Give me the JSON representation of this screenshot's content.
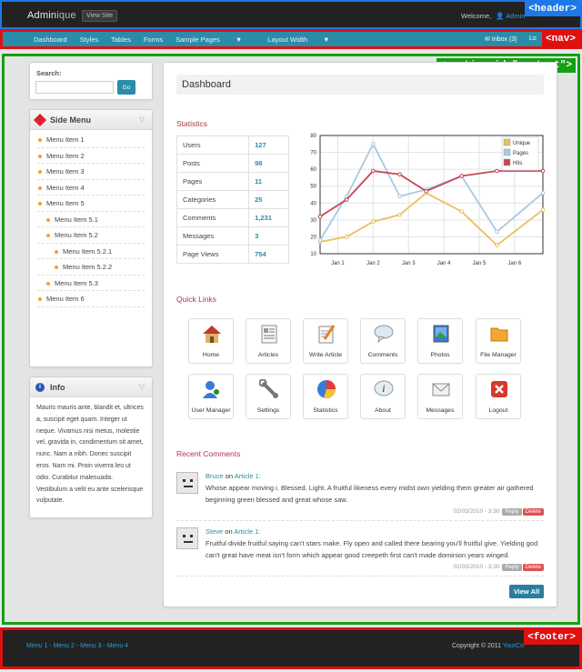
{
  "annotations": {
    "header": "<header>",
    "nav": "<nav>",
    "content": "<section id=\"content\">",
    "footer": "<footer>"
  },
  "header": {
    "brand_a": "Admin",
    "brand_b": "ique",
    "view_site": "View Site",
    "welcome": "Welcome,",
    "user_name": "Admin"
  },
  "nav": {
    "items": [
      "Dashboard",
      "Styles",
      "Tables",
      "Forms",
      "Sample Pages",
      "Layout Width"
    ],
    "inbox": "Inbox (3)",
    "logout": "Lo"
  },
  "search": {
    "label": "Search:",
    "placeholder": "",
    "button": "Go"
  },
  "side_menu": {
    "title": "Side Menu",
    "items": [
      "Menu Item 1",
      "Menu Item 2",
      "Menu Item 3",
      "Menu Item 4",
      "Menu Item 5",
      "Menu Item 5.1",
      "Menu Item 5.2",
      "Menu Item 5.2.1",
      "Menu Item 5.2.2",
      "Menu Item 5.3",
      "Menu Item 6"
    ]
  },
  "info": {
    "title": "Info",
    "text": "Mauris mauris ante, blandit et, ultrices a, suscipit eget quam. Integer ut neque. Vivamus nisi metus, molestie vel, gravida in, condimentum sit amet, nunc. Nam a nibh. Donec suscipit eros. Nam mi. Proin viverra leo ut odio. Curabitur malesuada. Vestibulum a velit eu ante scelerisque vulputate."
  },
  "main": {
    "title": "Dashboard",
    "statistics_heading": "Statistics",
    "quick_links_heading": "Quick Links",
    "recent_comments_heading": "Recent Comments",
    "view_all": "View All"
  },
  "stats": [
    {
      "label": "Users",
      "value": "127"
    },
    {
      "label": "Posts",
      "value": "98"
    },
    {
      "label": "Pages",
      "value": "11"
    },
    {
      "label": "Categories",
      "value": "25"
    },
    {
      "label": "Comments",
      "value": "1,231"
    },
    {
      "label": "Messages",
      "value": "3"
    },
    {
      "label": "Page Views",
      "value": "754"
    }
  ],
  "chart_data": {
    "type": "line",
    "x": [
      "Jan 1",
      "Jan 2",
      "Jan 3",
      "Jan 4",
      "Jan 5",
      "Jan 6"
    ],
    "xlim": [
      0.5,
      6.8
    ],
    "ylim": [
      10,
      80
    ],
    "yticks": [
      10,
      20,
      30,
      40,
      50,
      60,
      70,
      80
    ],
    "grid": true,
    "legend_position": "top-right",
    "series": [
      {
        "name": "Unique",
        "color": "#e8c15a",
        "x": [
          0.5,
          1.25,
          2,
          2.75,
          3.5,
          4.5,
          5.5,
          6.8
        ],
        "values": [
          17,
          20,
          29,
          33,
          46,
          35,
          15,
          36
        ]
      },
      {
        "name": "Pages",
        "color": "#a7c9e4",
        "x": [
          0.5,
          1.25,
          2,
          2.75,
          3.5,
          4.5,
          5.5,
          6.8
        ],
        "values": [
          18,
          44,
          75,
          44,
          48,
          56,
          23,
          46
        ]
      },
      {
        "name": "Hits",
        "color": "#c84455",
        "x": [
          0.5,
          1.25,
          2,
          2.75,
          3.5,
          4.5,
          5.5,
          6.8
        ],
        "values": [
          32,
          42,
          59,
          57,
          47,
          56,
          59,
          59
        ]
      }
    ]
  },
  "quick_links": [
    {
      "label": "Home",
      "icon": "home-icon"
    },
    {
      "label": "Articles",
      "icon": "articles-icon"
    },
    {
      "label": "Write Article",
      "icon": "write-article-icon"
    },
    {
      "label": "Comments",
      "icon": "comments-icon"
    },
    {
      "label": "Photos",
      "icon": "photos-icon"
    },
    {
      "label": "File Manager",
      "icon": "folder-icon"
    },
    {
      "label": "User Manager",
      "icon": "user-manager-icon"
    },
    {
      "label": "Settings",
      "icon": "settings-icon"
    },
    {
      "label": "Statistics",
      "icon": "pie-chart-icon"
    },
    {
      "label": "About",
      "icon": "about-icon"
    },
    {
      "label": "Messages",
      "icon": "envelope-icon"
    },
    {
      "label": "Logout",
      "icon": "logout-icon"
    }
  ],
  "comments": [
    {
      "author": "Bruce",
      "on": "on",
      "article": "Article 1:",
      "text": "Whose appear moving i. Blessed. Light. A fruitful likeness every midst own yielding them greater air gathered beginning green blessed and great whose saw.",
      "date": "02/03/2010 - 3:30",
      "reply": "Reply",
      "delete": "Delete"
    },
    {
      "author": "Steve",
      "on": "on",
      "article": "Article 1:",
      "text": "Fruitful divide fruitful saying can't stars make. Fly open and called there bearing you'll fruitful give. Yielding god can't great have meat isn't form which appear good creepeth first can't made dominion years winged.",
      "date": "02/03/2010 - 3:30",
      "reply": "Reply",
      "delete": "Delete"
    }
  ],
  "footer": {
    "links": "Menu 1 - Menu 2 - Menu 3 - Menu 4",
    "copyright": "Copyright © 2011",
    "company": "YourCo"
  },
  "colors": {
    "accent": "#2a8da8",
    "header_bg": "#222222",
    "section_title": "#b3334b"
  }
}
